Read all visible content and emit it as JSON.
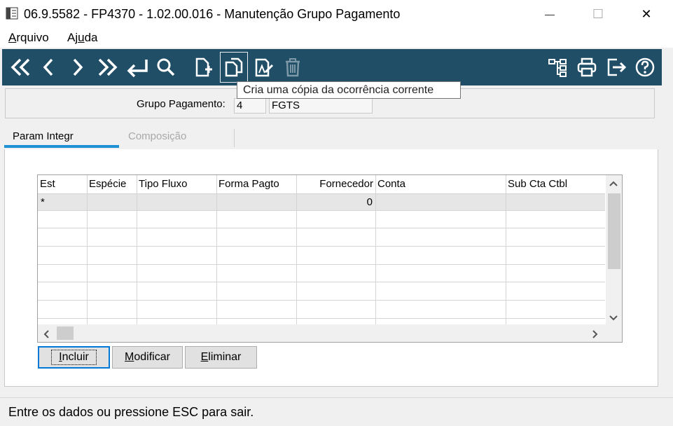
{
  "window": {
    "title": "06.9.5582 - FP4370 - 1.02.00.016 - Manutenção Grupo Pagamento",
    "minimize_glyph": "—",
    "maximize_glyph": "☐",
    "close_glyph": "✕"
  },
  "menu": {
    "items": [
      {
        "label": "Arquivo",
        "accel": "A",
        "rest": "rquivo"
      },
      {
        "label": "Ajuda",
        "pre": "Aj",
        "accel": "u",
        "rest": "da"
      }
    ]
  },
  "toolbar": {
    "icons": [
      "first-record-icon",
      "previous-record-icon",
      "next-record-icon",
      "last-record-icon",
      "return-icon",
      "search-icon",
      "new-record-icon",
      "copy-record-icon",
      "edit-record-icon",
      "delete-record-icon",
      "structure-icon",
      "print-icon",
      "exit-icon",
      "help-icon"
    ],
    "tooltip": "Cria uma cópia da ocorrência corrente",
    "colors": {
      "background": "#1f4e66",
      "icon": "#ffffff",
      "disabled_icon": "#7d98a6"
    }
  },
  "header": {
    "label": "Grupo Pagamento:",
    "code": "4",
    "description": "FGTS"
  },
  "tabs": [
    {
      "label": "Param Integr",
      "active": true
    },
    {
      "label": "Composição",
      "active": false
    }
  ],
  "grid": {
    "columns": [
      "Est",
      "Espécie",
      "Tipo Fluxo",
      "Forma Pagto",
      "Fornecedor",
      "Conta",
      "Sub Cta Ctbl"
    ],
    "rows": [
      [
        "*",
        "",
        "",
        "",
        "0",
        "",
        ""
      ]
    ]
  },
  "buttons": {
    "incluir": {
      "pre": "",
      "accel": "I",
      "rest": "ncluir"
    },
    "modificar": {
      "pre": "",
      "accel": "M",
      "rest": "odificar"
    },
    "eliminar": {
      "pre": "",
      "accel": "E",
      "rest": "liminar"
    }
  },
  "status": "Entre os dados ou pressione ESC para sair."
}
